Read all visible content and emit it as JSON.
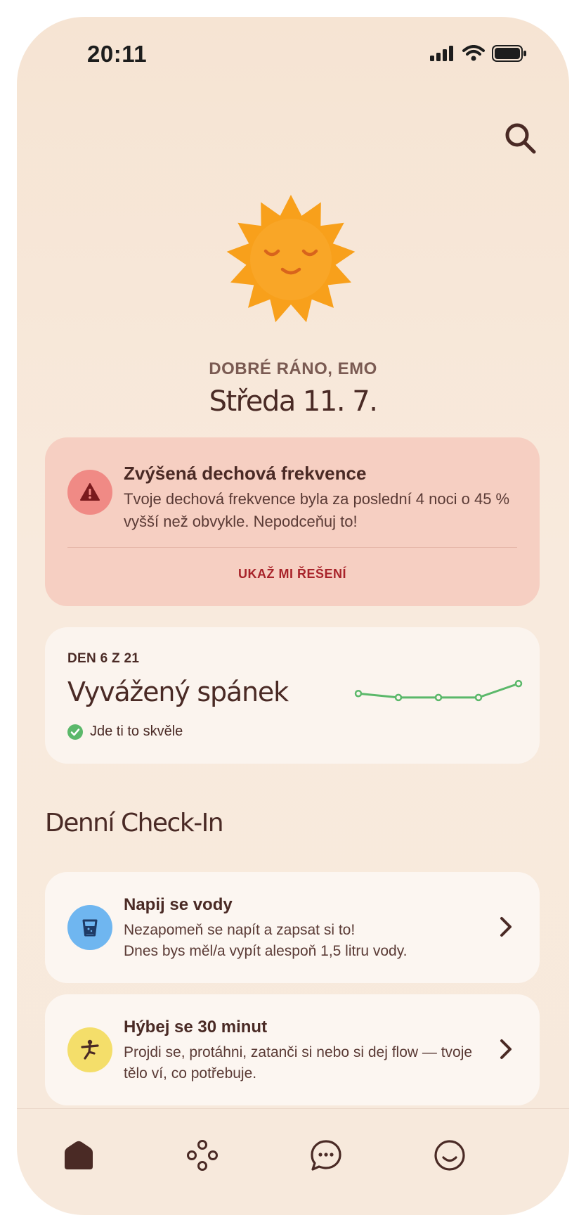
{
  "status_bar": {
    "time": "20:11"
  },
  "header": {
    "greeting": "DOBRÉ RÁNO, EMO",
    "date": "Středa 11. 7."
  },
  "alert": {
    "title": "Zvýšená dechová frekvence",
    "text": "Tvoje dechová frekvence byla za poslední 4 noci o 45 % vyšší než obvykle. Nepodceňuj to!",
    "action": "UKAŽ MI ŘEŠENÍ"
  },
  "program": {
    "overline": "DEN 6 Z 21",
    "title": "Vyvážený spánek",
    "status": "Jde ti to skvěle",
    "chart_data": {
      "type": "line",
      "values": [
        0.9,
        0.5,
        0.5,
        0.5,
        1.9
      ]
    }
  },
  "checkin": {
    "title": "Denní Check-In",
    "items": [
      {
        "title": "Napij se vody",
        "text": "Nezapomeň se napít a zapsat si to!\n Dnes bys měl/a vypít alespoň 1,5 litru vody.",
        "icon": "water-glass-icon",
        "color": "#6fb6f0"
      },
      {
        "title": "Hýbej se 30 minut",
        "text": "Projdi se, protáhni, zatanči si nebo si dej flow — tvoje tělo ví, co potřebuje.",
        "icon": "stretching-figure-icon",
        "color": "#f4de6a"
      }
    ]
  },
  "colors": {
    "background": "#f7e6d6",
    "alert_bg": "#f6cfc2",
    "accent_red": "#a8232a",
    "success_green": "#5bb86a"
  }
}
